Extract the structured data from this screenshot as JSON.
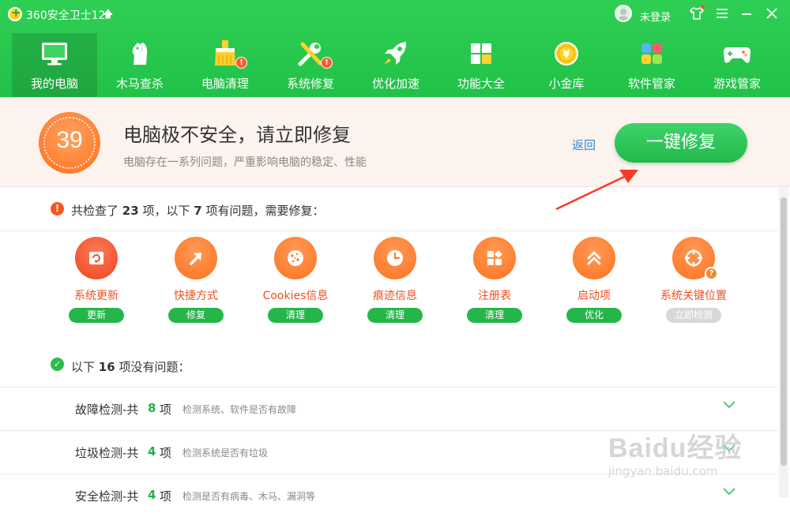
{
  "titlebar": {
    "app_title": "360安全卫士12",
    "login_text": "未登录"
  },
  "nav": {
    "items": [
      {
        "label": "我的电脑",
        "icon": "monitor-icon",
        "active": true,
        "badge": ""
      },
      {
        "label": "木马查杀",
        "icon": "horse-icon",
        "active": false,
        "badge": ""
      },
      {
        "label": "电脑清理",
        "icon": "broom-icon",
        "active": false,
        "badge": "!"
      },
      {
        "label": "系统修复",
        "icon": "wrench-icon",
        "active": false,
        "badge": "!"
      },
      {
        "label": "优化加速",
        "icon": "rocket-icon",
        "active": false,
        "badge": ""
      },
      {
        "label": "功能大全",
        "icon": "grid-icon",
        "active": false,
        "badge": ""
      },
      {
        "label": "小金库",
        "icon": "coin-icon",
        "active": false,
        "badge": ""
      },
      {
        "label": "软件管家",
        "icon": "apps-icon",
        "active": false,
        "badge": ""
      },
      {
        "label": "游戏管家",
        "icon": "gamepad-icon",
        "active": false,
        "badge": ""
      }
    ]
  },
  "banner": {
    "score": "39",
    "title": "电脑极不安全，请立即修复",
    "subtitle": "电脑存在一系列问题，严重影响电脑的稳定、性能",
    "back_label": "返回",
    "fix_label": "一键修复"
  },
  "problems": {
    "head_prefix": "共检查了",
    "total": "23",
    "head_mid1": "项，以下",
    "issue_count": "7",
    "head_suffix": "项有问题，需要修复：",
    "items": [
      {
        "label": "系统更新",
        "action": "更新",
        "icon": "windows-update-icon"
      },
      {
        "label": "快捷方式",
        "action": "修复",
        "icon": "shortcut-arrow-icon"
      },
      {
        "label": "Cookies信息",
        "action": "清理",
        "icon": "cookie-icon"
      },
      {
        "label": "痕迹信息",
        "action": "清理",
        "icon": "clock-icon"
      },
      {
        "label": "注册表",
        "action": "清理",
        "icon": "registry-icon"
      },
      {
        "label": "启动项",
        "action": "优化",
        "icon": "double-chevron-up-icon"
      },
      {
        "label": "系统关键位置",
        "action": "立即检测",
        "icon": "target-icon"
      }
    ]
  },
  "ok_section": {
    "prefix": "以下",
    "count": "16",
    "suffix": "项没有问题："
  },
  "categories": [
    {
      "name": "故障检测-共",
      "count": "8",
      "unit": "项",
      "desc": "检测系统、软件是否有故障"
    },
    {
      "name": "垃圾检测-共",
      "count": "4",
      "unit": "项",
      "desc": "检测系统是否有垃圾"
    },
    {
      "name": "安全检测-共",
      "count": "4",
      "unit": "项",
      "desc": "检测是否有病毒、木马、漏洞等"
    }
  ],
  "watermark": {
    "text": "Baidu经验",
    "url": "jingyan.baidu.com"
  },
  "colors": {
    "brand_green": "#22c148",
    "danger_orange": "#f0501e",
    "link_blue": "#2e8ad8"
  }
}
